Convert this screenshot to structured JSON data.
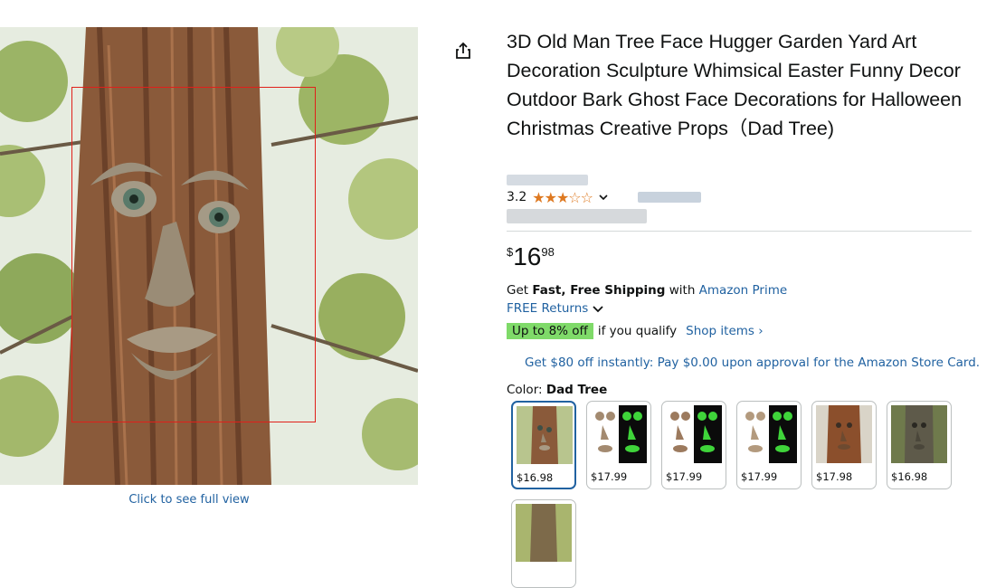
{
  "image_viewer": {
    "caption": "Click to see full view"
  },
  "product": {
    "title": "3D Old Man Tree Face Hugger Garden Yard Art Decoration Sculpture Whimsical Easter Funny Decor Outdoor Bark Ghost Face Decorations for Halloween Christmas Creative Props（Dad Tree)",
    "rating_value": "3.2",
    "stars": "★★★☆☆"
  },
  "price": {
    "symbol": "$",
    "whole": "16",
    "fraction": "98"
  },
  "shipping": {
    "prefix": "Get ",
    "bold": "Fast, Free Shipping",
    "middle": " with ",
    "link": "Amazon Prime",
    "returns": "FREE Returns"
  },
  "promo": {
    "badge": "Up to 8% off",
    "qualify": "if you qualify",
    "shop": "Shop items ›",
    "card_offer": "Get $80 off instantly: Pay $0.00 upon approval for the Amazon Store Card."
  },
  "color": {
    "label": "Color: ",
    "selected": "Dad Tree"
  },
  "swatches": [
    {
      "price": "$16.98"
    },
    {
      "price": "$17.99"
    },
    {
      "price": "$17.99"
    },
    {
      "price": "$17.99"
    },
    {
      "price": "$17.98"
    },
    {
      "price": "$16.98"
    }
  ],
  "colors": {
    "link": "#2162a1",
    "star": "#de7921",
    "badge": "#7fda69",
    "zoom_box": "#e0201a"
  }
}
